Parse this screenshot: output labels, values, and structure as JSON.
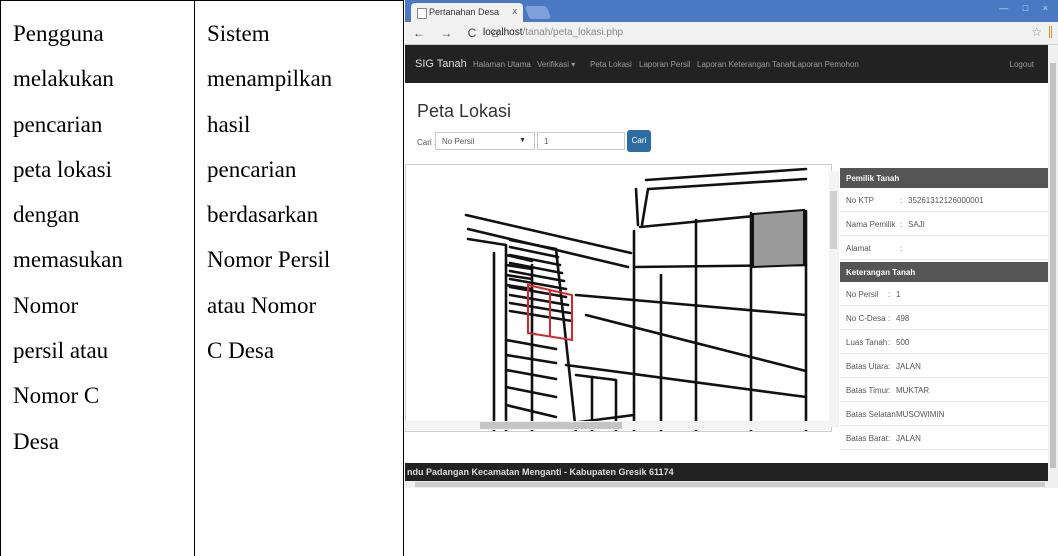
{
  "doc": {
    "col1_lines": [
      "Pengguna",
      "melakukan",
      "pencarian",
      "peta lokasi",
      "dengan",
      "memasukan",
      "Nomor",
      "persil atau",
      "Nomor C",
      "Desa"
    ],
    "col2_lines": [
      "Sistem",
      "menampilkan",
      "hasil",
      "pencarian",
      "berdasarkan",
      "Nomor Persil",
      "atau Nomor",
      "C Desa"
    ]
  },
  "browser": {
    "tab_title": "Pertanahan Desa",
    "tab_close": "x",
    "nav_glyphs": "← → C ⌂",
    "url_host": "localhost",
    "url_path": "/tanah/peta_lokasi.php",
    "star_icon": "☆",
    "window_controls": "— □ ×"
  },
  "navbar": {
    "brand": "SIG Tanah",
    "items": [
      "Halaman Utama",
      "Verifikasi ▾",
      "Peta Lokasi",
      "Laporan Persil",
      "Laporan Keterangan Tanah",
      "Laporan Pemohon"
    ],
    "logout": "Logout"
  },
  "page": {
    "title": "Peta Lokasi",
    "search_label": "Cari :",
    "search_select": "No Persil",
    "search_value": "1",
    "search_button": "Cari"
  },
  "info": {
    "owner_header": "Pemilik Tanah",
    "owner_rows": [
      {
        "k": "No KTP",
        "sep": ":",
        "v": "35261312126000001"
      },
      {
        "k": "Nama Pemilik",
        "sep": ":",
        "v": "SAJI"
      },
      {
        "k": "Alamat",
        "sep": ":",
        "v": ""
      }
    ],
    "land_header": "Keterangan Tanah",
    "land_rows": [
      {
        "k": "No Persil",
        "sep": ":",
        "v": "1"
      },
      {
        "k": "No C-Desa",
        "sep": ":",
        "v": "498"
      },
      {
        "k": "Luas Tanah",
        "sep": ":",
        "v": "500"
      },
      {
        "k": "Batas Utara",
        "sep": ":",
        "v": "JALAN"
      },
      {
        "k": "Batas Timur",
        "sep": ":",
        "v": "MUKTAR"
      },
      {
        "k": "Batas Selatan",
        "sep": ":",
        "v": "MUSOWIMIN"
      },
      {
        "k": "Batas Barat",
        "sep": ":",
        "v": "JALAN"
      }
    ]
  },
  "footer": {
    "text": "ndu Padangan Kecamatan Menganti - Kabupaten Gresik 61174"
  },
  "colors": {
    "navbar": "#222222",
    "button": "#2d6ca2",
    "highlight_parcel": "#d9262c",
    "filled_parcel": "#9a9a9a"
  }
}
